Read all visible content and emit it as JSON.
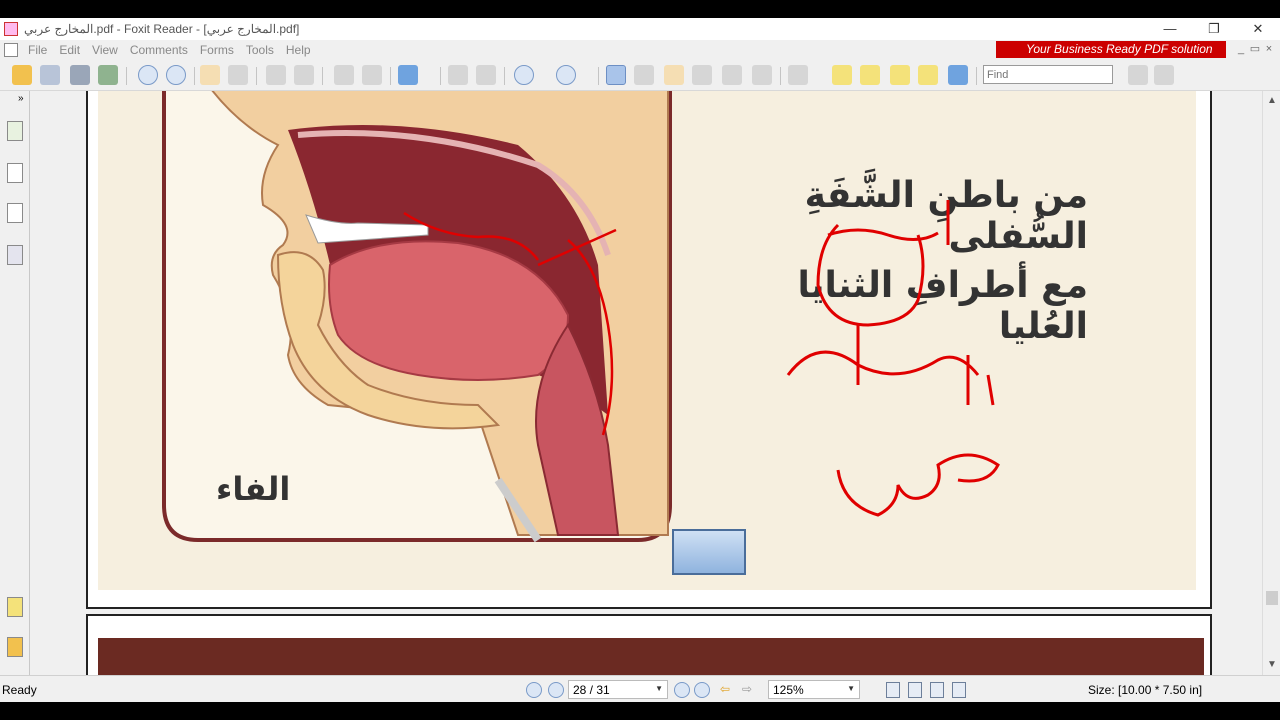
{
  "window": {
    "title": "المخارج عربي.pdf - Foxit Reader - [المخارج عربي.pdf]",
    "minimize": "—",
    "restore": "❐",
    "close": "✕"
  },
  "menu": {
    "items": [
      "File",
      "Edit",
      "View",
      "Comments",
      "Forms",
      "Tools",
      "Help"
    ],
    "promo": "Your Business Ready PDF solution"
  },
  "toolbar": {
    "find_placeholder": "Find"
  },
  "document": {
    "diagram_label": "الفاء",
    "heading_line1": "من باطنِ الشَّفَةِ السُّفلى",
    "heading_line2": "مع أطرافِ الثنايا العُليا",
    "annotation_ink_color": "#e00000"
  },
  "status": {
    "ready": "Ready",
    "page": "28 / 31",
    "zoom": "125%",
    "size": "Size: [10.00 * 7.50 in]"
  }
}
